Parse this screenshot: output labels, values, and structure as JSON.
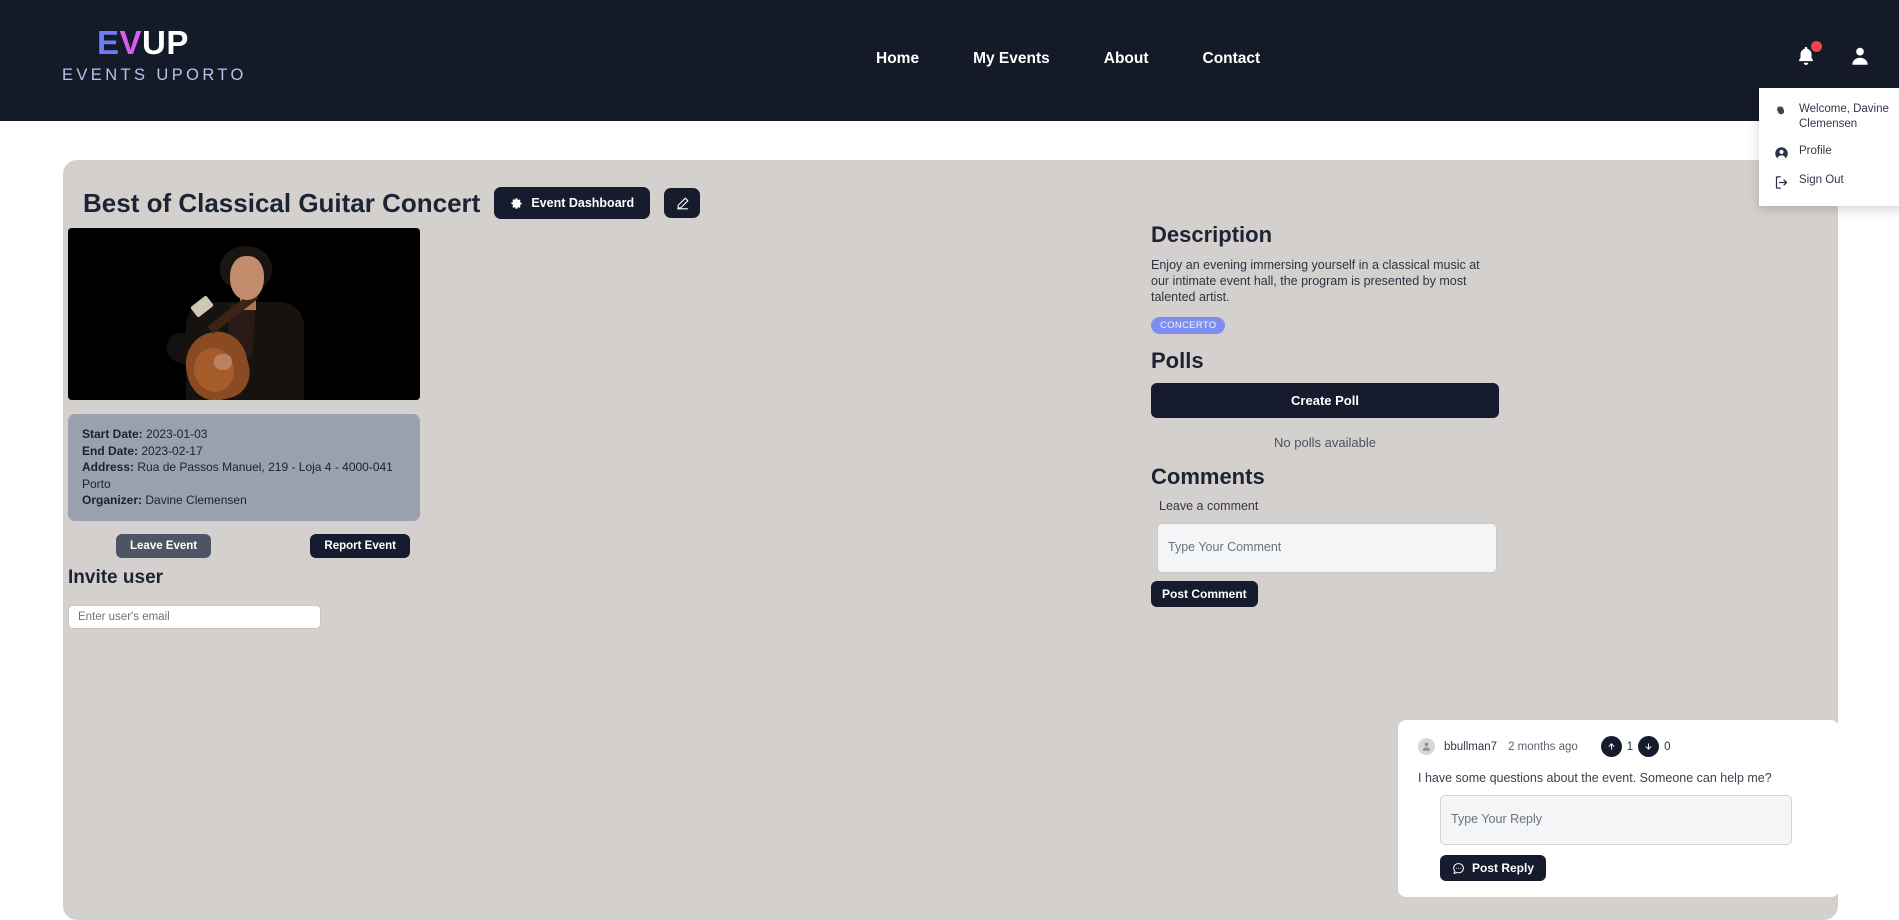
{
  "navbar": {
    "logo": {
      "part1": "EV",
      "part2": "V",
      "part3": "UP",
      "e": "E",
      "v": "V",
      "up": "UP",
      "subtitle": "EVENTS UPORTO"
    },
    "links": [
      {
        "label": "Home"
      },
      {
        "label": "My Events"
      },
      {
        "label": "About"
      },
      {
        "label": "Contact"
      }
    ],
    "notification_icon": "bell-icon",
    "has_notification_badge": true,
    "avatar_icon": "user-avatar-icon"
  },
  "user_menu": {
    "welcome": "Welcome, Davine Clemensen",
    "welcome_icon": "waving-hand-icon",
    "items": [
      {
        "label": "Profile",
        "icon": "user-circle-icon"
      },
      {
        "label": "Sign Out",
        "icon": "sign-out-icon"
      }
    ]
  },
  "event": {
    "title": "Best of Classical Guitar Concert",
    "dashboard_button": "Event Dashboard",
    "dashboard_icon": "gear-icon",
    "edit_icon": "pencil-square-icon",
    "image_alt": "classical guitarist performing on dark stage",
    "details": {
      "start_date_label": "Start Date:",
      "start_date": "2023-01-03",
      "end_date_label": "End Date:",
      "end_date": "2023-02-17",
      "address_label": "Address:",
      "address": "Rua de Passos Manuel, 219 - Loja 4 - 4000-041 Porto",
      "organizer_label": "Organizer:",
      "organizer": "Davine Clemensen"
    },
    "leave_button": "Leave Event",
    "report_button": "Report Event",
    "invite_heading": "Invite user",
    "invite_placeholder": "Enter user's email",
    "invite_value": ""
  },
  "description": {
    "heading": "Description",
    "text": "Enjoy an evening immersing yourself in a classical music at our intimate event hall, the program is presented by most talented artist.",
    "tag": "CONCERTO"
  },
  "polls": {
    "heading": "Polls",
    "create_button": "Create Poll",
    "empty_text": "No polls available"
  },
  "comments": {
    "heading": "Comments",
    "leave_label": "Leave a comment",
    "comment_placeholder": "Type Your Comment",
    "comment_value": "",
    "post_button": "Post Comment",
    "list": [
      {
        "author": "bbullman7",
        "time": "2 months ago",
        "upvotes": "1",
        "downvotes": "0",
        "text": "I have some questions about the event. Someone can help me?",
        "reply_placeholder": "Type Your Reply",
        "reply_value": "",
        "reply_button": "Post Reply",
        "reply_icon": "chat-bubble-icon"
      }
    ]
  },
  "colors": {
    "navbar_bg": "#151a28",
    "card_bg": "#d4d0ce",
    "dark_button": "#161c2d",
    "grey_button": "#4d5564",
    "info_box_bg": "#9aa0ae",
    "tag_bg": "#7e8ef0",
    "badge_red": "#ef4444",
    "logo_e": "#6f7bf7",
    "logo_v": "#d55ef0"
  }
}
